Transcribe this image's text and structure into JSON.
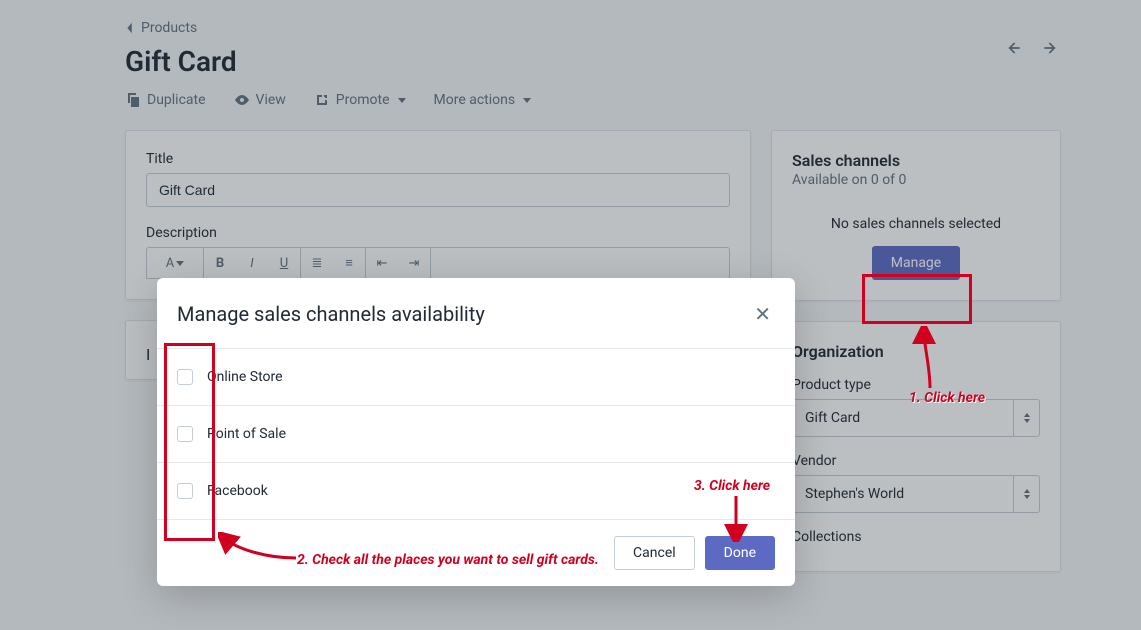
{
  "breadcrumb": {
    "label": "Products"
  },
  "page": {
    "title": "Gift Card"
  },
  "actions": {
    "duplicate": "Duplicate",
    "view": "View",
    "promote": "Promote",
    "more": "More actions"
  },
  "main": {
    "title_label": "Title",
    "title_value": "Gift Card",
    "description_label": "Description"
  },
  "sidebar": {
    "sales_channels": {
      "title": "Sales channels",
      "subtitle": "Available on 0 of 0",
      "empty": "No sales channels selected",
      "manage": "Manage"
    },
    "organization": {
      "title": "Organization",
      "product_type_label": "Product type",
      "product_type_value": "Gift Card",
      "vendor_label": "Vendor",
      "vendor_value": "Stephen's World",
      "collections_label": "Collections"
    }
  },
  "modal": {
    "title": "Manage sales channels availability",
    "channels": [
      {
        "label": "Online Store"
      },
      {
        "label": "Point of Sale"
      },
      {
        "label": "Facebook"
      }
    ],
    "cancel": "Cancel",
    "done": "Done"
  },
  "annotations": {
    "step1": "1. Click here",
    "step2": "2. Check all the places you want to sell gift cards.",
    "step3": "3. Click here"
  }
}
